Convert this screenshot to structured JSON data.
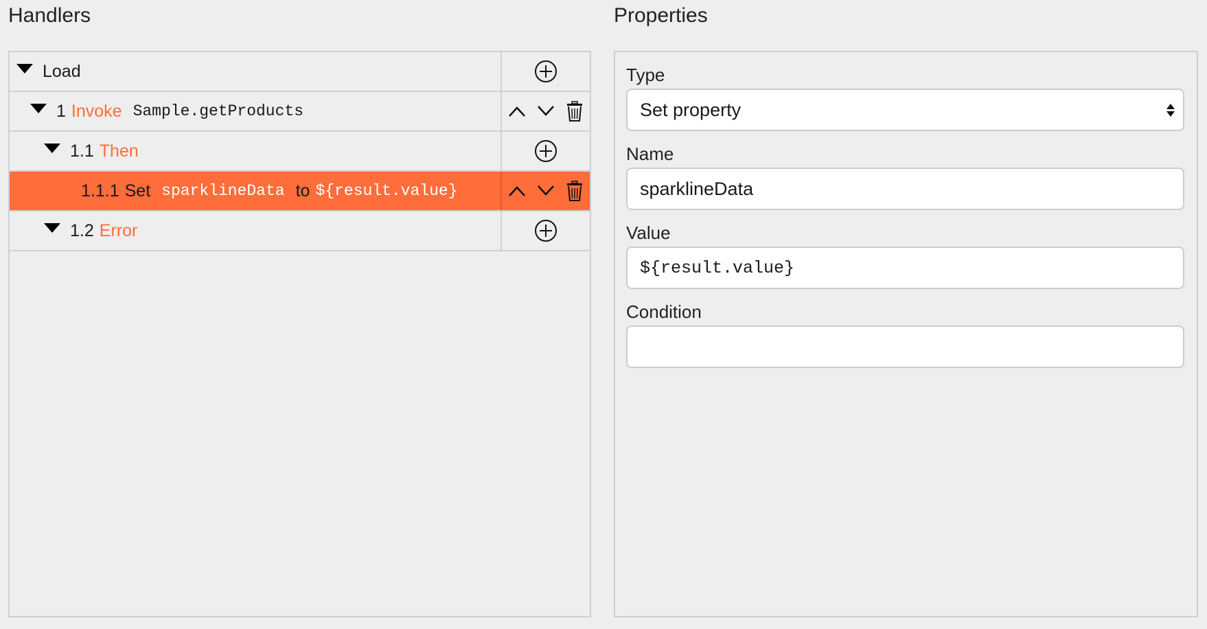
{
  "handlers": {
    "title": "Handlers",
    "rows": [
      {
        "level": 0,
        "num": "",
        "keyword": "Load",
        "keyword_colored": false,
        "arg": ""
      },
      {
        "level": 1,
        "num": "1",
        "keyword": "Invoke",
        "keyword_colored": true,
        "arg": "Sample.getProducts"
      },
      {
        "level": 2,
        "num": "1.1",
        "keyword": "Then",
        "keyword_colored": true,
        "arg": ""
      },
      {
        "level": 3,
        "num": "1.1.1",
        "keyword": "Set",
        "arg": "sparklineData",
        "connector": "to",
        "value": "${result.value}",
        "selected": true
      },
      {
        "level": 2,
        "num": "1.2",
        "keyword": "Error",
        "keyword_colored": true,
        "arg": ""
      }
    ]
  },
  "properties": {
    "title": "Properties",
    "type": {
      "label": "Type",
      "value": "Set property"
    },
    "name": {
      "label": "Name",
      "value": "sparklineData"
    },
    "value": {
      "label": "Value",
      "value": "${result.value}"
    },
    "condition": {
      "label": "Condition",
      "value": ""
    }
  },
  "colors": {
    "accent": "#ff6d3a",
    "background": "#eeeeee",
    "border": "#cfcfcf"
  },
  "icons": {
    "expand": "caret-down-icon",
    "add": "plus-circle-icon",
    "move_up": "chevron-up-icon",
    "move_down": "chevron-down-icon",
    "delete": "trash-icon"
  }
}
